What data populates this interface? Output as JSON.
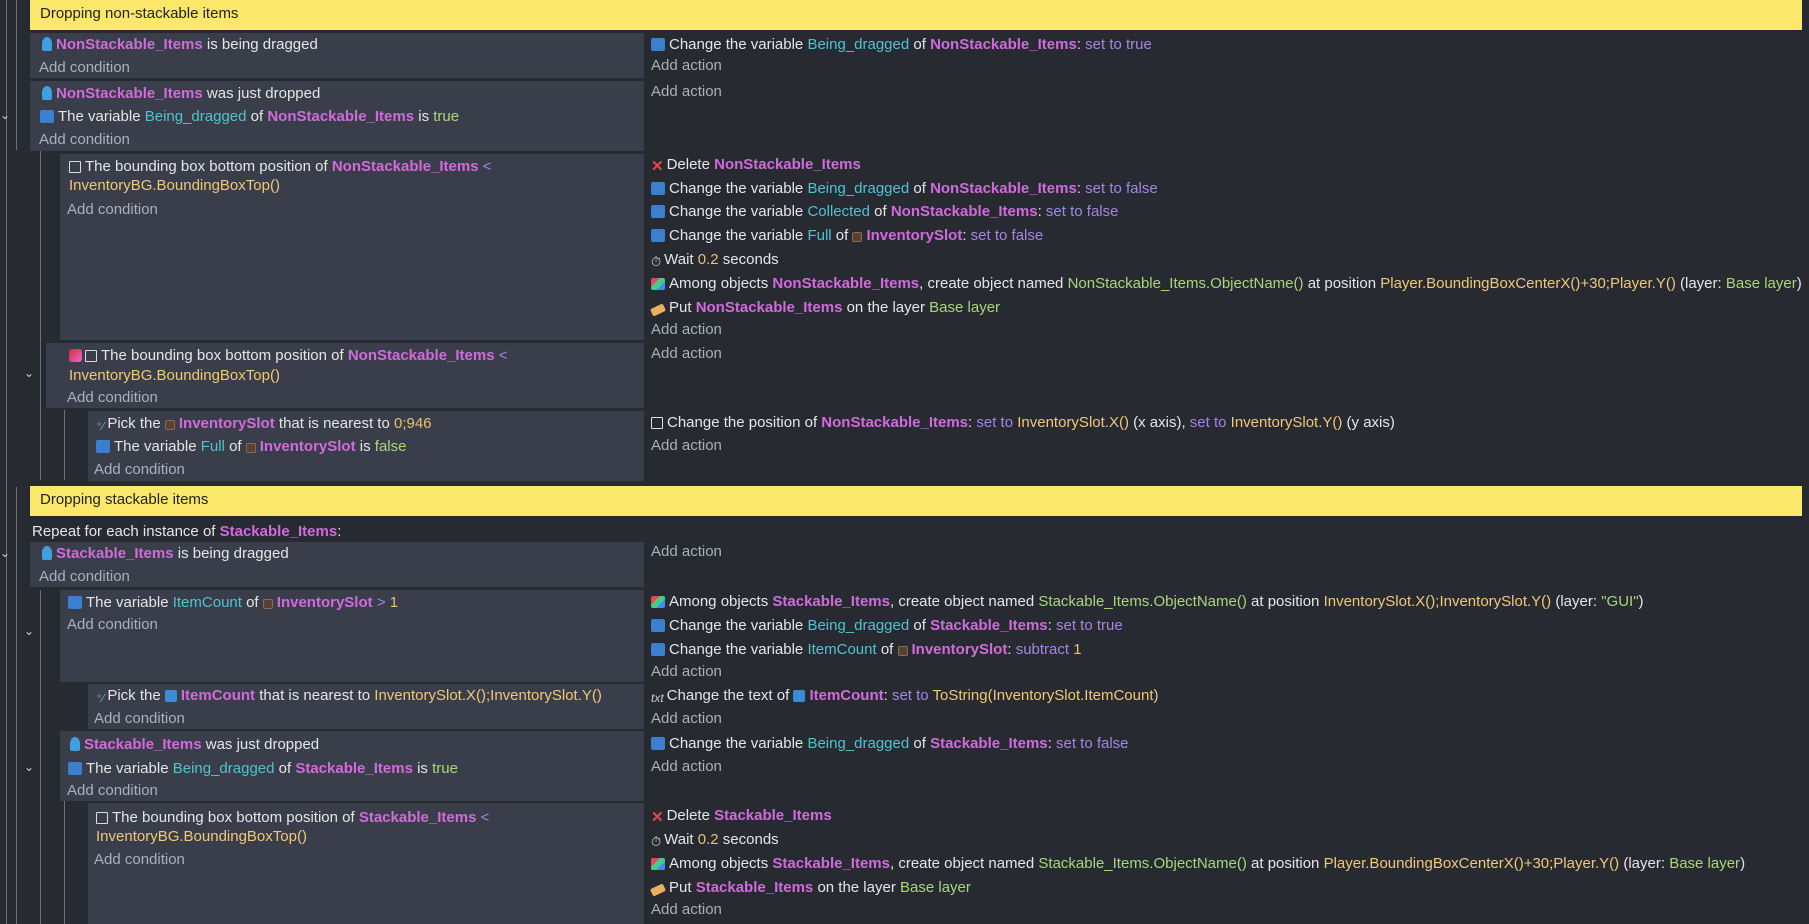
{
  "comments": {
    "non_stackable": "Dropping non-stackable items",
    "stackable": "Dropping stackable items"
  },
  "repeat": {
    "prefix": "Repeat for each instance of",
    "object": "Stackable_Items",
    "suffix": ":"
  },
  "labels": {
    "add_condition": "Add condition",
    "add_action": "Add action",
    "is_being_dragged": "is being dragged",
    "was_just_dropped": "was just dropped",
    "the_variable": "The variable",
    "of": "of",
    "is": "is",
    "change_the_variable": "Change the variable",
    "set_to": "set to",
    "bbox_bottom": "The bounding box bottom position of",
    "delete": "Delete",
    "wait": "Wait",
    "seconds": "seconds",
    "among_objects": "Among objects",
    "create_object_named": ", create object named",
    "at_position": "at position",
    "layer_open": "(layer:",
    "close_paren": ")",
    "put": "Put",
    "on_the_layer": "on the layer",
    "pick_the": "Pick the",
    "nearest_to": "that is nearest to",
    "change_position_of": "Change the position of",
    "x_axis": "(x axis),",
    "y_axis": "(y axis)",
    "change_text_of": "Change the text of",
    "subtract": "subtract",
    "lt": "<",
    "gt": ">"
  },
  "objects": {
    "nonstack": "NonStackable_Items",
    "stack": "Stackable_Items",
    "slot": "InventorySlot",
    "itemcount_obj": "ItemCount"
  },
  "vars": {
    "being_dragged": "Being_dragged",
    "collected": "Collected",
    "full": "Full",
    "itemcount": "ItemCount"
  },
  "values": {
    "true": "true",
    "false": "false",
    "set_true": "set to true",
    "set_false": "set to false",
    "wait_time": "0.2",
    "one": "1",
    "pos_946": "0;946",
    "base_layer": "Base layer",
    "gui_layer": "\"GUI\""
  },
  "exprs": {
    "bbox_top": "InventoryBG.BoundingBoxTop()",
    "nonstack_name": "NonStackable_Items.ObjectName()",
    "stack_name": "Stackable_Items.ObjectName()",
    "player_pos": "Player.BoundingBoxCenterX()+30;Player.Y()",
    "slot_pos": "InventorySlot.X();InventorySlot.Y()",
    "slot_x": "InventorySlot.X()",
    "slot_y": "InventorySlot.Y()",
    "tostring": "ToString(InventorySlot.ItemCount)"
  }
}
